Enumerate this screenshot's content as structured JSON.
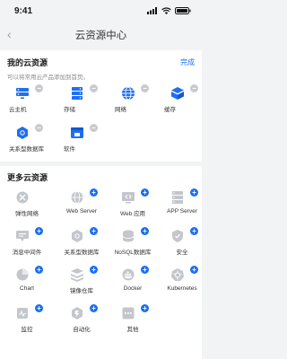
{
  "status": {
    "time": "9:41"
  },
  "nav": {
    "title": "云资源中心"
  },
  "my": {
    "title": "我的云资源",
    "done": "完成",
    "hint": "可以将常用云产品添加到首页。",
    "items": [
      {
        "label": "云主机",
        "icon": "server-icon"
      },
      {
        "label": "存储",
        "icon": "storage-icon"
      },
      {
        "label": "网络",
        "icon": "globe-icon"
      },
      {
        "label": "缓存",
        "icon": "cache-icon"
      },
      {
        "label": "关系型数据库",
        "icon": "database-icon"
      },
      {
        "label": "软件",
        "icon": "software-icon"
      }
    ]
  },
  "more": {
    "title": "更多云资源",
    "items": [
      {
        "label": "弹性网络",
        "icon": "elastic-network-icon"
      },
      {
        "label": "Web Server",
        "icon": "web-server-icon"
      },
      {
        "label": "Web 应用",
        "icon": "web-app-icon"
      },
      {
        "label": "APP Server",
        "icon": "app-server-icon"
      },
      {
        "label": "消息中间件",
        "icon": "message-queue-icon"
      },
      {
        "label": "关系型数据库",
        "icon": "relational-db-icon"
      },
      {
        "label": "NoSQL数据库",
        "icon": "nosql-icon"
      },
      {
        "label": "安全",
        "icon": "security-icon"
      },
      {
        "label": "Chart",
        "icon": "chart-icon"
      },
      {
        "label": "镜像仓库",
        "icon": "image-registry-icon"
      },
      {
        "label": "Docker",
        "icon": "docker-icon"
      },
      {
        "label": "Kubernetes",
        "icon": "kubernetes-icon"
      },
      {
        "label": "监控",
        "icon": "monitor-icon"
      },
      {
        "label": "自动化",
        "icon": "automation-icon"
      },
      {
        "label": "其他",
        "icon": "other-icon"
      }
    ]
  },
  "colors": {
    "accent": "#1e6ff1",
    "gray_icon": "#c3c7cc",
    "background": "#f2f3f5"
  }
}
